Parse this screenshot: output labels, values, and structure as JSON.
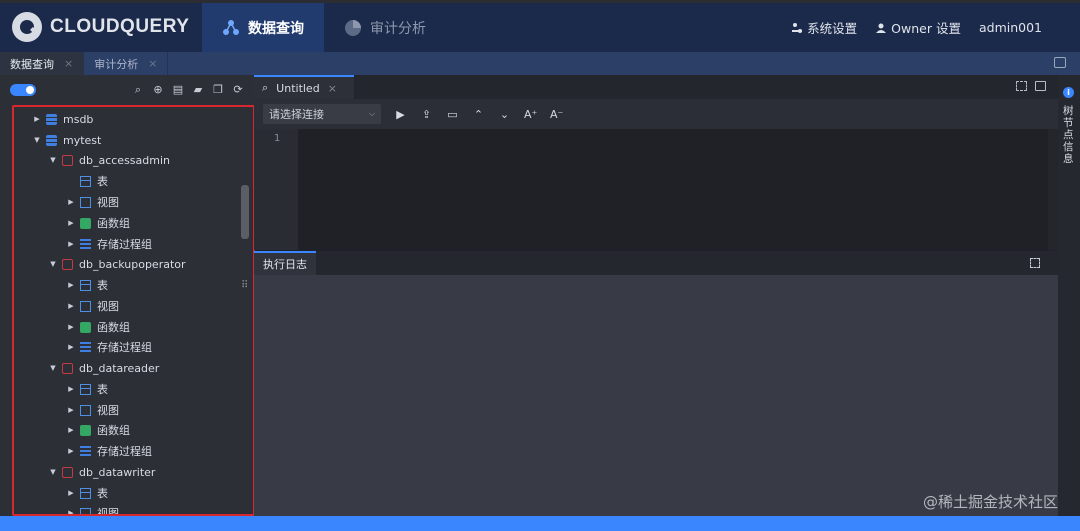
{
  "app": {
    "logo_text": "CLOUDQUERY"
  },
  "nav": {
    "items": [
      {
        "label": "数据查询",
        "icon": "data-query-icon",
        "active": true
      },
      {
        "label": "审计分析",
        "icon": "audit-chart-icon",
        "active": false
      }
    ]
  },
  "header_right": {
    "system_settings": "系统设置",
    "owner_settings": "Owner 设置",
    "user": "admin001"
  },
  "page_tabs": [
    {
      "label": "数据查询",
      "close": "×",
      "active": true
    },
    {
      "label": "审计分析",
      "close": "×",
      "active": false
    }
  ],
  "tree": {
    "nodes": [
      {
        "label": "msdb",
        "type": "database",
        "expanded": false
      },
      {
        "label": "mytest",
        "type": "database",
        "expanded": true
      },
      {
        "label": "db_accessadmin",
        "type": "schema",
        "expanded": true
      },
      {
        "label": "表",
        "type": "table",
        "expanded": false
      },
      {
        "label": "视图",
        "type": "view",
        "expanded": false
      },
      {
        "label": "函数组",
        "type": "function",
        "expanded": false
      },
      {
        "label": "存储过程组",
        "type": "procedure",
        "expanded": false
      },
      {
        "label": "db_backupoperator",
        "type": "schema",
        "expanded": true
      },
      {
        "label": "表",
        "type": "table",
        "expanded": false
      },
      {
        "label": "视图",
        "type": "view",
        "expanded": false
      },
      {
        "label": "函数组",
        "type": "function",
        "expanded": false
      },
      {
        "label": "存储过程组",
        "type": "procedure",
        "expanded": false
      },
      {
        "label": "db_datareader",
        "type": "schema",
        "expanded": true
      },
      {
        "label": "表",
        "type": "table",
        "expanded": false
      },
      {
        "label": "视图",
        "type": "view",
        "expanded": false
      },
      {
        "label": "函数组",
        "type": "function",
        "expanded": false
      },
      {
        "label": "存储过程组",
        "type": "procedure",
        "expanded": false
      },
      {
        "label": "db_datawriter",
        "type": "schema",
        "expanded": true
      },
      {
        "label": "表",
        "type": "table",
        "expanded": false
      },
      {
        "label": "视图",
        "type": "view",
        "expanded": false
      }
    ]
  },
  "editor": {
    "tab_label": "Untitled",
    "tab_close": "×",
    "connection_placeholder": "请选择连接",
    "line_numbers": [
      "1"
    ]
  },
  "log": {
    "tab_label": "执行日志"
  },
  "right_rail": {
    "label": "树节点信息",
    "info_icon": "i"
  },
  "watermark": "@稀土掘金技术社区",
  "colors": {
    "accent": "#3a86ff",
    "header": "#1b2a4a",
    "highlight_border": "#d8272e"
  }
}
